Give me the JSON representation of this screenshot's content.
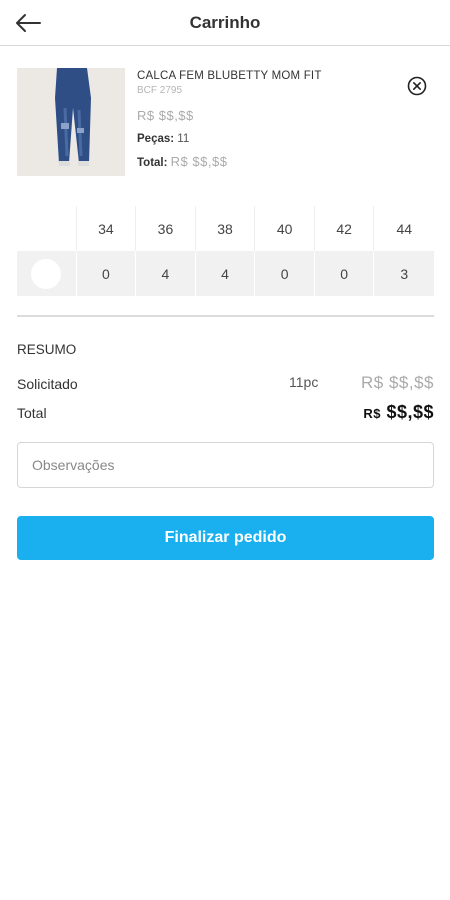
{
  "header": {
    "title": "Carrinho",
    "back_icon": "arrow-left-icon"
  },
  "product": {
    "name": "CALCA FEM BLUBETTY MOM FIT",
    "code": "BCF 2795",
    "price": "R$ $$,$$",
    "qty_label": "Peças:",
    "qty_value": "11",
    "total_label": "Total:",
    "total_value": "R$ $$,$$",
    "remove_icon": "close-circle-icon"
  },
  "sizes": {
    "headers": [
      "34",
      "36",
      "38",
      "40",
      "42",
      "44"
    ],
    "values": [
      "0",
      "4",
      "4",
      "0",
      "0",
      "3"
    ]
  },
  "summary": {
    "title": "RESUMO",
    "requested_label": "Solicitado",
    "requested_pieces": "11pc",
    "requested_value": "R$ $$,$$",
    "total_label": "Total",
    "total_currency": "R$",
    "total_value": "$$,$$"
  },
  "notes": {
    "placeholder": "Observações"
  },
  "checkout": {
    "label": "Finalizar pedido"
  },
  "colors": {
    "accent": "#1ab0ef"
  }
}
